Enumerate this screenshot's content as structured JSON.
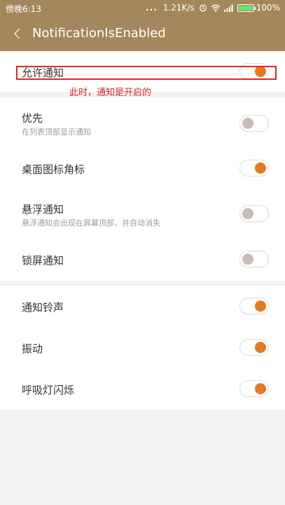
{
  "status_bar": {
    "time": "傍晚6:13",
    "dots": "...",
    "network_speed": "1.21K/s",
    "battery_percent": "100%",
    "battery_level": 1.0,
    "battery_color": "#6ee36e"
  },
  "header": {
    "title": "NotificationIsEnabled",
    "background_color": "#a5875d"
  },
  "annotation": {
    "text": "此时，通知是开启的",
    "color": "#e0252a"
  },
  "accent_color": "#e67a20",
  "sections": [
    {
      "rows": [
        {
          "title": "允许通知",
          "subtitle": "",
          "enabled": true
        }
      ]
    },
    {
      "rows": [
        {
          "title": "优先",
          "subtitle": "在列表顶部显示通知",
          "enabled": false
        },
        {
          "title": "桌面图标角标",
          "subtitle": "",
          "enabled": true
        },
        {
          "title": "悬浮通知",
          "subtitle": "悬浮通知会出现在屏幕顶部，并自动消失",
          "enabled": false
        },
        {
          "title": "锁屏通知",
          "subtitle": "",
          "enabled": false
        }
      ]
    },
    {
      "rows": [
        {
          "title": "通知铃声",
          "subtitle": "",
          "enabled": true
        },
        {
          "title": "振动",
          "subtitle": "",
          "enabled": true
        },
        {
          "title": "呼吸灯闪烁",
          "subtitle": "",
          "enabled": true
        }
      ]
    }
  ]
}
